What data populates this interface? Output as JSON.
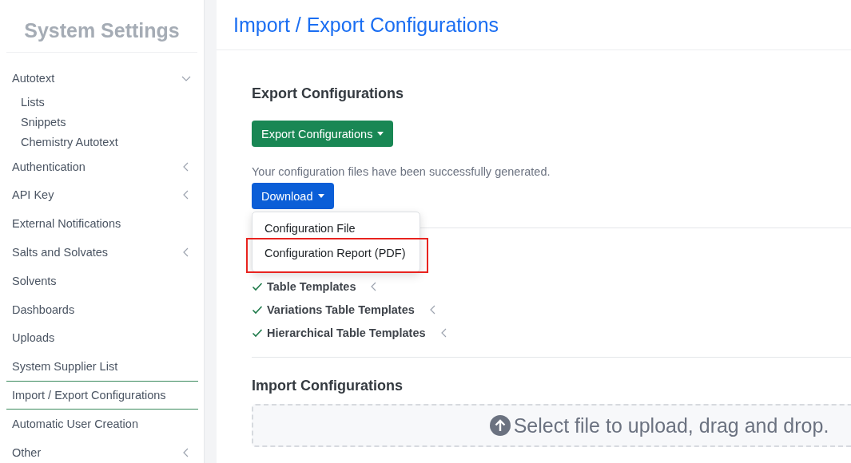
{
  "sidebar": {
    "title": "System Settings",
    "items": [
      {
        "label": "Autotext",
        "expanded": true,
        "selected": false,
        "children": [
          {
            "label": "Lists"
          },
          {
            "label": "Snippets"
          },
          {
            "label": "Chemistry Autotext"
          }
        ]
      },
      {
        "label": "Authentication",
        "expanded": false,
        "selected": false
      },
      {
        "label": "API Key",
        "expanded": false,
        "selected": false
      },
      {
        "label": "External Notifications",
        "selected": false
      },
      {
        "label": "Salts and Solvates",
        "expanded": false,
        "selected": false
      },
      {
        "label": "Solvents",
        "selected": false
      },
      {
        "label": "Dashboards",
        "selected": false
      },
      {
        "label": "Uploads",
        "selected": false
      },
      {
        "label": "System Supplier List",
        "selected": false
      },
      {
        "label": "Import / Export Configurations",
        "selected": true
      },
      {
        "label": "Automatic User Creation",
        "selected": false
      },
      {
        "label": "Other",
        "expanded": false,
        "selected": false
      }
    ]
  },
  "page": {
    "title": "Import / Export Configurations"
  },
  "export": {
    "heading": "Export Configurations",
    "button": "Export Configurations",
    "message": "Your configuration files have been successfully generated.",
    "download_button": "Download",
    "download_menu": {
      "items": [
        {
          "label": "Configuration File",
          "highlighted": false
        },
        {
          "label": "Configuration Report (PDF)",
          "highlighted": true
        }
      ]
    },
    "items": [
      {
        "label": "Table Templates",
        "checked": true
      },
      {
        "label": "Variations Table Templates",
        "checked": true
      },
      {
        "label": "Hierarchical Table Templates",
        "checked": true
      }
    ]
  },
  "import": {
    "heading": "Import Configurations",
    "dropzone": "Select file to upload, drag and drop."
  }
}
